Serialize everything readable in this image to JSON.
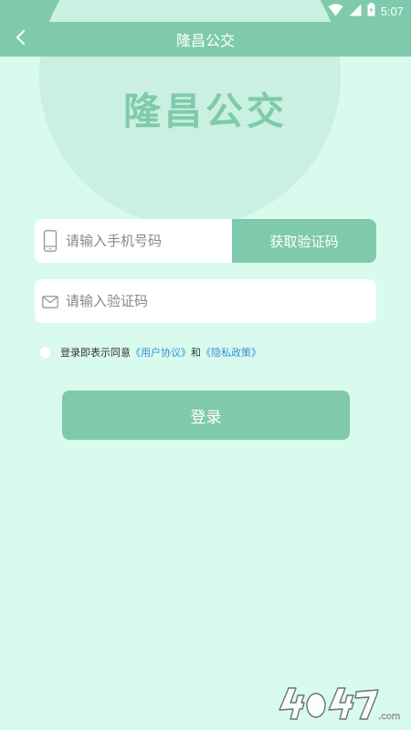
{
  "status_bar": {
    "time": "5:07",
    "icons": [
      "wifi-icon",
      "cellular-signal-icon",
      "battery-icon"
    ]
  },
  "header": {
    "title": "隆昌公交",
    "back_icon": "chevron-left-icon"
  },
  "brand": {
    "title": "隆昌公交"
  },
  "phone": {
    "placeholder": "请输入手机号码",
    "value": "",
    "icon": "phone-icon",
    "get_code_label": "获取验证码"
  },
  "code": {
    "placeholder": "请输入验证码",
    "value": "",
    "icon": "mail-icon"
  },
  "agreement": {
    "checked": false,
    "prefix": "登录即表示同意",
    "user_agreement": "《用户协议》",
    "conjunction": "和",
    "privacy_policy": "《隐私政策》"
  },
  "login": {
    "label": "登录"
  },
  "colors": {
    "accent": "#7fcaad",
    "background": "#d8fbee",
    "link": "#3a8fd6"
  },
  "watermark": {
    "text": "4O4O7.com"
  }
}
